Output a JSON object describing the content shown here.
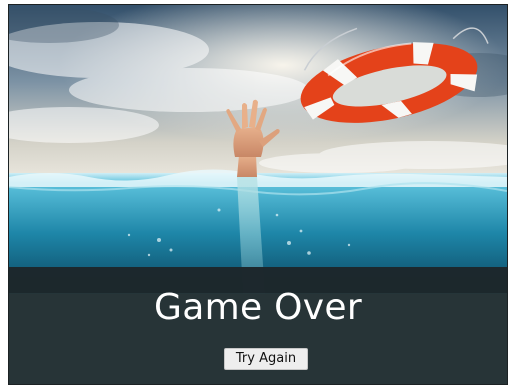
{
  "game": {
    "title": "Game Over",
    "retry_label": "Try Again"
  },
  "scene": {
    "description_icons": [
      "lifebuoy-icon",
      "drowning-hand"
    ],
    "colors": {
      "sky_top": "#3c5d78",
      "sky_glow": "#f3efe6",
      "sea_surface": "#bfe6f2",
      "sea_deep": "#0a4a63",
      "lifebuoy_red": "#e4421a",
      "lifebuoy_white": "#f7f7f5",
      "panel": "#263437"
    }
  }
}
